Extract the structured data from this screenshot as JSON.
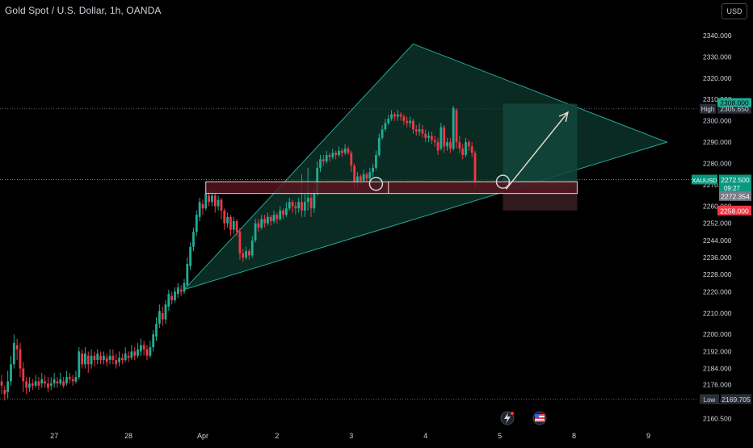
{
  "header": {
    "title": "Gold Spot / U.S. Dollar, 1h, OANDA",
    "currency_button": "USD"
  },
  "chart_data": {
    "type": "candlestick",
    "symbol": "XAUUSD",
    "ylim": [
      2157,
      2346
    ],
    "y_ticks": [
      2160.5,
      2168.5,
      2176.5,
      2184.0,
      2192.0,
      2200.0,
      2210.0,
      2220.0,
      2228.0,
      2236.0,
      2244.0,
      2252.0,
      2260.0,
      2270.0,
      2280.0,
      2290.0,
      2300.0,
      2310.0,
      2320.0,
      2330.0,
      2340.0
    ],
    "y_tick_labels": [
      "2160.500",
      "2168.500",
      "2176.000",
      "2184.000",
      "2192.000",
      "2200.000",
      "2210.000",
      "2220.000",
      "2228.000",
      "2236.000",
      "2244.000",
      "2252.000",
      "2260.000",
      "2270.000",
      "2280.000",
      "2290.000",
      "2300.000",
      "2310.000",
      "2320.000",
      "2330.000",
      "2340.000"
    ],
    "x_ticks": [
      {
        "label": "27",
        "bar": 17
      },
      {
        "label": "28",
        "bar": 41
      },
      {
        "label": "Apr",
        "bar": 65
      },
      {
        "label": "2",
        "bar": 89
      },
      {
        "label": "3",
        "bar": 113
      },
      {
        "label": "4",
        "bar": 137
      },
      {
        "label": "5",
        "bar": 161
      },
      {
        "label": "8",
        "bar": 185
      },
      {
        "label": "9",
        "bar": 209
      }
    ],
    "price_labels": {
      "high": {
        "tag": "High",
        "value": "2305.650",
        "price": 2305.65
      },
      "low": {
        "tag": "Low",
        "value": "2169.705",
        "price": 2169.705
      },
      "last": {
        "tag": "XAUUSD",
        "value": "2272.500",
        "countdown": "09:27",
        "price": 2272.5
      },
      "entry": {
        "value": "2272.354",
        "price": 2268.2
      },
      "target": {
        "value": "2308.000",
        "price": 2308.0
      },
      "stop": {
        "value": "2258.000",
        "price": 2258.0
      }
    },
    "hlines": [
      2305.65,
      2169.705,
      2272.5
    ],
    "drawings": {
      "triangle": [
        [
          59,
          2221
        ],
        [
          133,
          2336
        ],
        [
          215,
          2290
        ]
      ],
      "support_zone": {
        "bar_from": 66,
        "bar_to": 186,
        "price_top": 2271.5,
        "price_bottom": 2266.0
      },
      "long_position": {
        "bar_from": 162,
        "bar_to": 186,
        "target": 2308.0,
        "entry": 2268.2,
        "stop": 2258.0
      },
      "arrow": [
        [
          163,
          2268
        ],
        [
          183,
          2304
        ]
      ],
      "circles": [
        [
          121,
          2270.5
        ],
        [
          162,
          2271.5
        ]
      ]
    },
    "colors": {
      "up": "#22ab94",
      "down": "#f23645",
      "background": "#000000",
      "triangle_fill": "#0e3a2e",
      "triangle_line": "#26a69a",
      "target_fill": "#12463b",
      "stop_fill": "#3a1f24",
      "zone_fill": "#5b1420"
    },
    "candles": [
      [
        2178,
        2176,
        2172,
        2181
      ],
      [
        2174,
        2172,
        2169,
        2176
      ],
      [
        2173,
        2178,
        2170,
        2183
      ],
      [
        2178,
        2186,
        2176,
        2190
      ],
      [
        2186,
        2196,
        2184,
        2200
      ],
      [
        2195,
        2193,
        2188,
        2198
      ],
      [
        2193,
        2184,
        2180,
        2196
      ],
      [
        2184,
        2178,
        2173,
        2187
      ],
      [
        2178,
        2175,
        2172,
        2180
      ],
      [
        2175,
        2177,
        2173,
        2180
      ],
      [
        2177,
        2176,
        2174,
        2179
      ],
      [
        2176,
        2178,
        2175,
        2181
      ],
      [
        2178,
        2176,
        2174,
        2180
      ],
      [
        2177,
        2179,
        2175,
        2182
      ],
      [
        2178,
        2177,
        2175,
        2181
      ],
      [
        2177,
        2175,
        2173,
        2180
      ],
      [
        2176,
        2177,
        2174,
        2180
      ],
      [
        2177,
        2179,
        2175,
        2182
      ],
      [
        2178,
        2177,
        2175,
        2180
      ],
      [
        2177,
        2179,
        2176,
        2182
      ],
      [
        2178,
        2176,
        2175,
        2180
      ],
      [
        2177,
        2180,
        2176,
        2183
      ],
      [
        2180,
        2179,
        2177,
        2182
      ],
      [
        2179,
        2178,
        2176,
        2181
      ],
      [
        2178,
        2180,
        2177,
        2183
      ],
      [
        2180,
        2192,
        2179,
        2194
      ],
      [
        2191,
        2186,
        2184,
        2193
      ],
      [
        2186,
        2191,
        2184,
        2194
      ],
      [
        2190,
        2186,
        2182,
        2192
      ],
      [
        2186,
        2190,
        2184,
        2193
      ],
      [
        2190,
        2188,
        2185,
        2192
      ],
      [
        2188,
        2191,
        2186,
        2193
      ],
      [
        2190,
        2188,
        2186,
        2192
      ],
      [
        2188,
        2190,
        2186,
        2192
      ],
      [
        2189,
        2187,
        2185,
        2191
      ],
      [
        2188,
        2190,
        2186,
        2193
      ],
      [
        2190,
        2188,
        2186,
        2193
      ],
      [
        2188,
        2186,
        2184,
        2191
      ],
      [
        2187,
        2189,
        2185,
        2192
      ],
      [
        2189,
        2188,
        2186,
        2191
      ],
      [
        2188,
        2191,
        2187,
        2194
      ],
      [
        2190,
        2189,
        2187,
        2192
      ],
      [
        2189,
        2192,
        2188,
        2195
      ],
      [
        2192,
        2190,
        2188,
        2194
      ],
      [
        2190,
        2193,
        2189,
        2196
      ],
      [
        2192,
        2195,
        2190,
        2198
      ],
      [
        2195,
        2193,
        2190,
        2197
      ],
      [
        2193,
        2190,
        2188,
        2195
      ],
      [
        2190,
        2194,
        2189,
        2197
      ],
      [
        2194,
        2200,
        2192,
        2202
      ],
      [
        2199,
        2205,
        2197,
        2208
      ],
      [
        2205,
        2211,
        2203,
        2214
      ],
      [
        2210,
        2207,
        2204,
        2213
      ],
      [
        2207,
        2214,
        2205,
        2216
      ],
      [
        2213,
        2219,
        2211,
        2221
      ],
      [
        2218,
        2216,
        2214,
        2220
      ],
      [
        2216,
        2220,
        2215,
        2222
      ],
      [
        2219,
        2222,
        2217,
        2224
      ],
      [
        2221,
        2220,
        2218,
        2223
      ],
      [
        2220,
        2224,
        2219,
        2226
      ],
      [
        2223,
        2233,
        2222,
        2236
      ],
      [
        2232,
        2241,
        2230,
        2243
      ],
      [
        2241,
        2248,
        2239,
        2250
      ],
      [
        2248,
        2256,
        2246,
        2258
      ],
      [
        2255,
        2262,
        2253,
        2264
      ],
      [
        2261,
        2259,
        2256,
        2263
      ],
      [
        2259,
        2266,
        2258,
        2268
      ],
      [
        2265,
        2262,
        2260,
        2267
      ],
      [
        2262,
        2265,
        2260,
        2267
      ],
      [
        2265,
        2260,
        2257,
        2266
      ],
      [
        2260,
        2263,
        2258,
        2265
      ],
      [
        2263,
        2258,
        2254,
        2264
      ],
      [
        2258,
        2252,
        2249,
        2259
      ],
      [
        2252,
        2255,
        2250,
        2257
      ],
      [
        2255,
        2249,
        2246,
        2256
      ],
      [
        2249,
        2253,
        2247,
        2255
      ],
      [
        2253,
        2248,
        2246,
        2254
      ],
      [
        2248,
        2238,
        2235,
        2250
      ],
      [
        2238,
        2236,
        2234,
        2240
      ],
      [
        2236,
        2239,
        2235,
        2241
      ],
      [
        2239,
        2237,
        2235,
        2240
      ],
      [
        2237,
        2244,
        2236,
        2246
      ],
      [
        2244,
        2252,
        2243,
        2254
      ],
      [
        2252,
        2250,
        2248,
        2254
      ],
      [
        2250,
        2254,
        2249,
        2256
      ],
      [
        2254,
        2252,
        2250,
        2256
      ],
      [
        2252,
        2255,
        2251,
        2257
      ],
      [
        2255,
        2253,
        2251,
        2256
      ],
      [
        2253,
        2256,
        2252,
        2258
      ],
      [
        2256,
        2254,
        2252,
        2257
      ],
      [
        2254,
        2258,
        2253,
        2260
      ],
      [
        2258,
        2256,
        2254,
        2259
      ],
      [
        2256,
        2259,
        2255,
        2262
      ],
      [
        2259,
        2262,
        2258,
        2264
      ],
      [
        2262,
        2260,
        2257,
        2263
      ],
      [
        2260,
        2259,
        2256,
        2262
      ],
      [
        2259,
        2262,
        2257,
        2264
      ],
      [
        2262,
        2258,
        2255,
        2275
      ],
      [
        2258,
        2262,
        2255,
        2266
      ],
      [
        2262,
        2264,
        2258,
        2278
      ],
      [
        2264,
        2259,
        2255,
        2266
      ],
      [
        2259,
        2266,
        2257,
        2268
      ],
      [
        2266,
        2278,
        2265,
        2281
      ],
      [
        2278,
        2282,
        2276,
        2284
      ],
      [
        2282,
        2281,
        2279,
        2284
      ],
      [
        2281,
        2284,
        2280,
        2286
      ],
      [
        2284,
        2283,
        2281,
        2285
      ],
      [
        2283,
        2285,
        2282,
        2287
      ],
      [
        2285,
        2284,
        2282,
        2286
      ],
      [
        2284,
        2286,
        2283,
        2288
      ],
      [
        2286,
        2285,
        2283,
        2287
      ],
      [
        2285,
        2287,
        2284,
        2289
      ],
      [
        2287,
        2285,
        2284,
        2288
      ],
      [
        2285,
        2279,
        2276,
        2286
      ],
      [
        2279,
        2271,
        2268,
        2280
      ],
      [
        2271,
        2274,
        2269,
        2276
      ],
      [
        2274,
        2272,
        2270,
        2275
      ],
      [
        2272,
        2275,
        2271,
        2277
      ],
      [
        2275,
        2273,
        2271,
        2276
      ],
      [
        2273,
        2276,
        2272,
        2278
      ],
      [
        2276,
        2278,
        2274,
        2280
      ],
      [
        2278,
        2284,
        2277,
        2286
      ],
      [
        2284,
        2292,
        2283,
        2294
      ],
      [
        2292,
        2296,
        2291,
        2298
      ],
      [
        2296,
        2299,
        2295,
        2301
      ],
      [
        2299,
        2301,
        2298,
        2303
      ],
      [
        2301,
        2303,
        2300,
        2305
      ],
      [
        2303,
        2302,
        2300,
        2304
      ],
      [
        2302,
        2303,
        2300,
        2305
      ],
      [
        2303,
        2302,
        2300,
        2304
      ],
      [
        2302,
        2300,
        2298,
        2303
      ],
      [
        2300,
        2299,
        2297,
        2302
      ],
      [
        2299,
        2300,
        2297,
        2302
      ],
      [
        2300,
        2296,
        2294,
        2301
      ],
      [
        2296,
        2295,
        2293,
        2298
      ],
      [
        2295,
        2296,
        2293,
        2299
      ],
      [
        2296,
        2294,
        2292,
        2298
      ],
      [
        2294,
        2292,
        2290,
        2296
      ],
      [
        2292,
        2293,
        2290,
        2295
      ],
      [
        2293,
        2291,
        2289,
        2295
      ],
      [
        2291,
        2290,
        2288,
        2293
      ],
      [
        2290,
        2286,
        2284,
        2292
      ],
      [
        2287,
        2297,
        2286,
        2299
      ],
      [
        2297,
        2288,
        2285,
        2298
      ],
      [
        2288,
        2290,
        2286,
        2292
      ],
      [
        2290,
        2287,
        2285,
        2292
      ],
      [
        2287,
        2306,
        2286,
        2307
      ],
      [
        2305,
        2290,
        2287,
        2306
      ],
      [
        2290,
        2287,
        2285,
        2293
      ],
      [
        2287,
        2284,
        2282,
        2289
      ],
      [
        2284,
        2290,
        2283,
        2292
      ],
      [
        2290,
        2288,
        2286,
        2291
      ],
      [
        2288,
        2285,
        2283,
        2290
      ],
      [
        2285,
        2272,
        2269,
        2286
      ]
    ]
  }
}
